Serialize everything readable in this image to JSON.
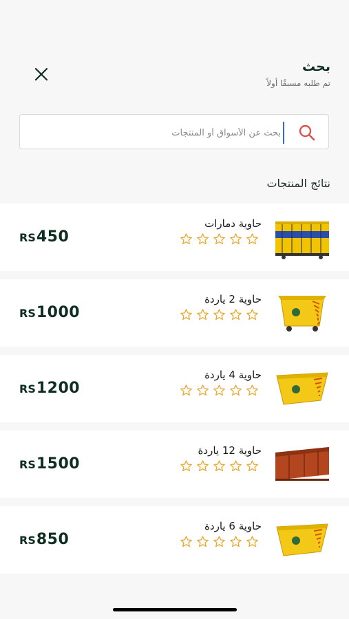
{
  "header": {
    "title": "بحث",
    "subtitle": "تم طلبه مسبقًا أولاً"
  },
  "search": {
    "placeholder": "بحث عن الأسواق أو المنتجات",
    "value": ""
  },
  "results_title": "نتائج المنتجات",
  "colors": {
    "primary": "#0f2e22",
    "star": "#e8a72c",
    "search_icon": "#d9534f",
    "card": "#ffffff",
    "background": "#f7f7f7"
  },
  "products": [
    {
      "name": "حاوية دمارات",
      "currency": "RS",
      "price": "450",
      "rating": 0,
      "image": "yellow-blue-roll-off-container"
    },
    {
      "name": "حاوية 2 ياردة",
      "currency": "RS",
      "price": "1000",
      "rating": 0,
      "image": "yellow-wheeled-bin"
    },
    {
      "name": "حاوية 4 ياردة",
      "currency": "RS",
      "price": "1200",
      "rating": 0,
      "image": "yellow-skip-container"
    },
    {
      "name": "حاوية 12 ياردة",
      "currency": "RS",
      "price": "1500",
      "rating": 0,
      "image": "orange-open-container"
    },
    {
      "name": "حاوية 6 ياردة",
      "currency": "RS",
      "price": "850",
      "rating": 0,
      "image": "yellow-skip-container"
    }
  ]
}
